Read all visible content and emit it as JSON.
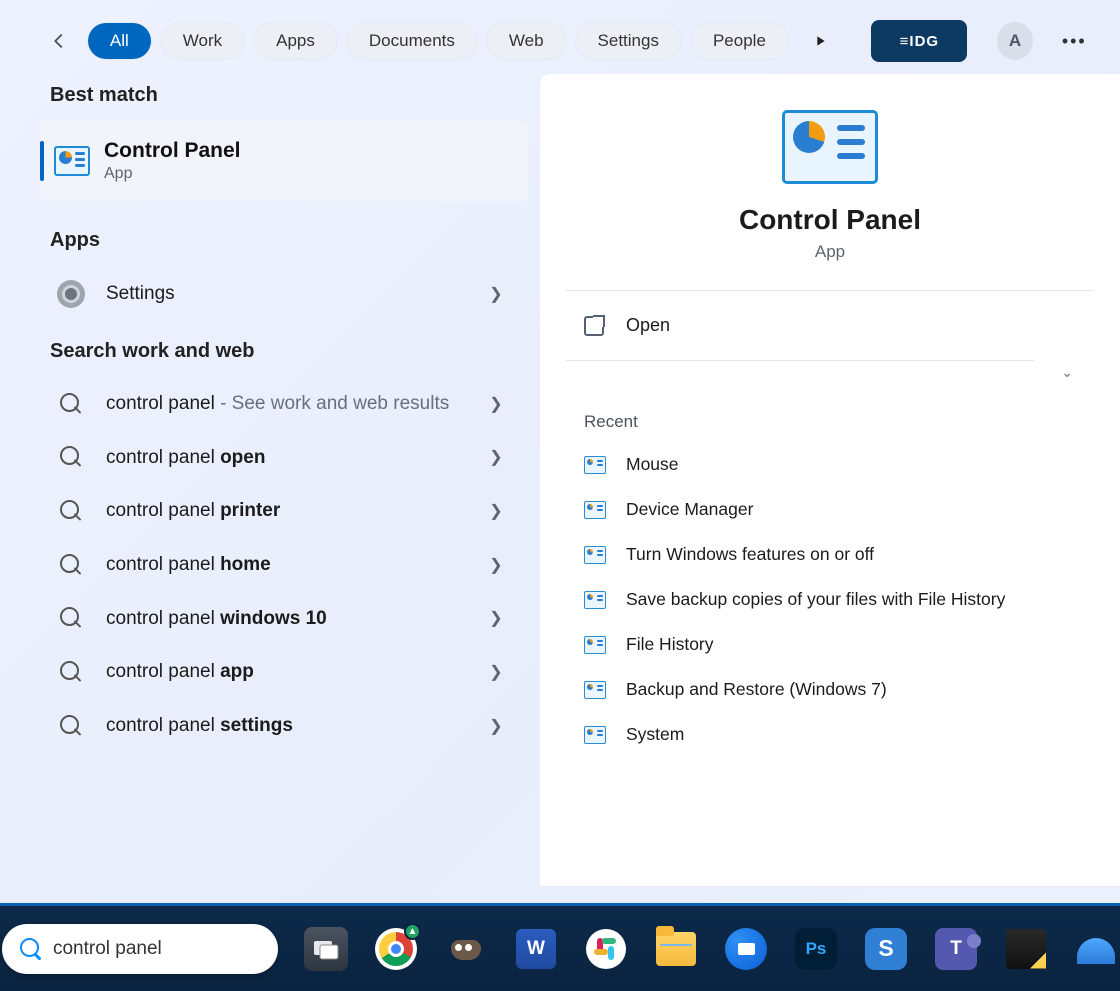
{
  "filters": {
    "tabs": [
      "All",
      "Work",
      "Apps",
      "Documents",
      "Web",
      "Settings",
      "People"
    ],
    "active": "All",
    "badge": "≡IDG",
    "avatar": "A"
  },
  "sections": {
    "best": "Best match",
    "apps": "Apps",
    "webwork": "Search work and web"
  },
  "bestMatch": {
    "title": "Control Panel",
    "subtitle": "App"
  },
  "appsList": [
    {
      "label": "Settings"
    }
  ],
  "suggestions": [
    {
      "prefix": "control panel",
      "suffix": " - See work and web results",
      "bold": ""
    },
    {
      "prefix": "control panel ",
      "bold": "open",
      "suffix": ""
    },
    {
      "prefix": "control panel ",
      "bold": "printer",
      "suffix": ""
    },
    {
      "prefix": "control panel ",
      "bold": "home",
      "suffix": ""
    },
    {
      "prefix": "control panel ",
      "bold": "windows 10",
      "suffix": ""
    },
    {
      "prefix": "control panel ",
      "bold": "app",
      "suffix": ""
    },
    {
      "prefix": "control panel ",
      "bold": "settings",
      "suffix": ""
    }
  ],
  "detail": {
    "title": "Control Panel",
    "subtitle": "App",
    "open": "Open",
    "recentHeading": "Recent",
    "recent": [
      "Mouse",
      "Device Manager",
      "Turn Windows features on or off",
      "Save backup copies of your files with File History",
      "File History",
      "Backup and Restore (Windows 7)",
      "System"
    ]
  },
  "taskbar": {
    "searchValue": "control panel"
  }
}
